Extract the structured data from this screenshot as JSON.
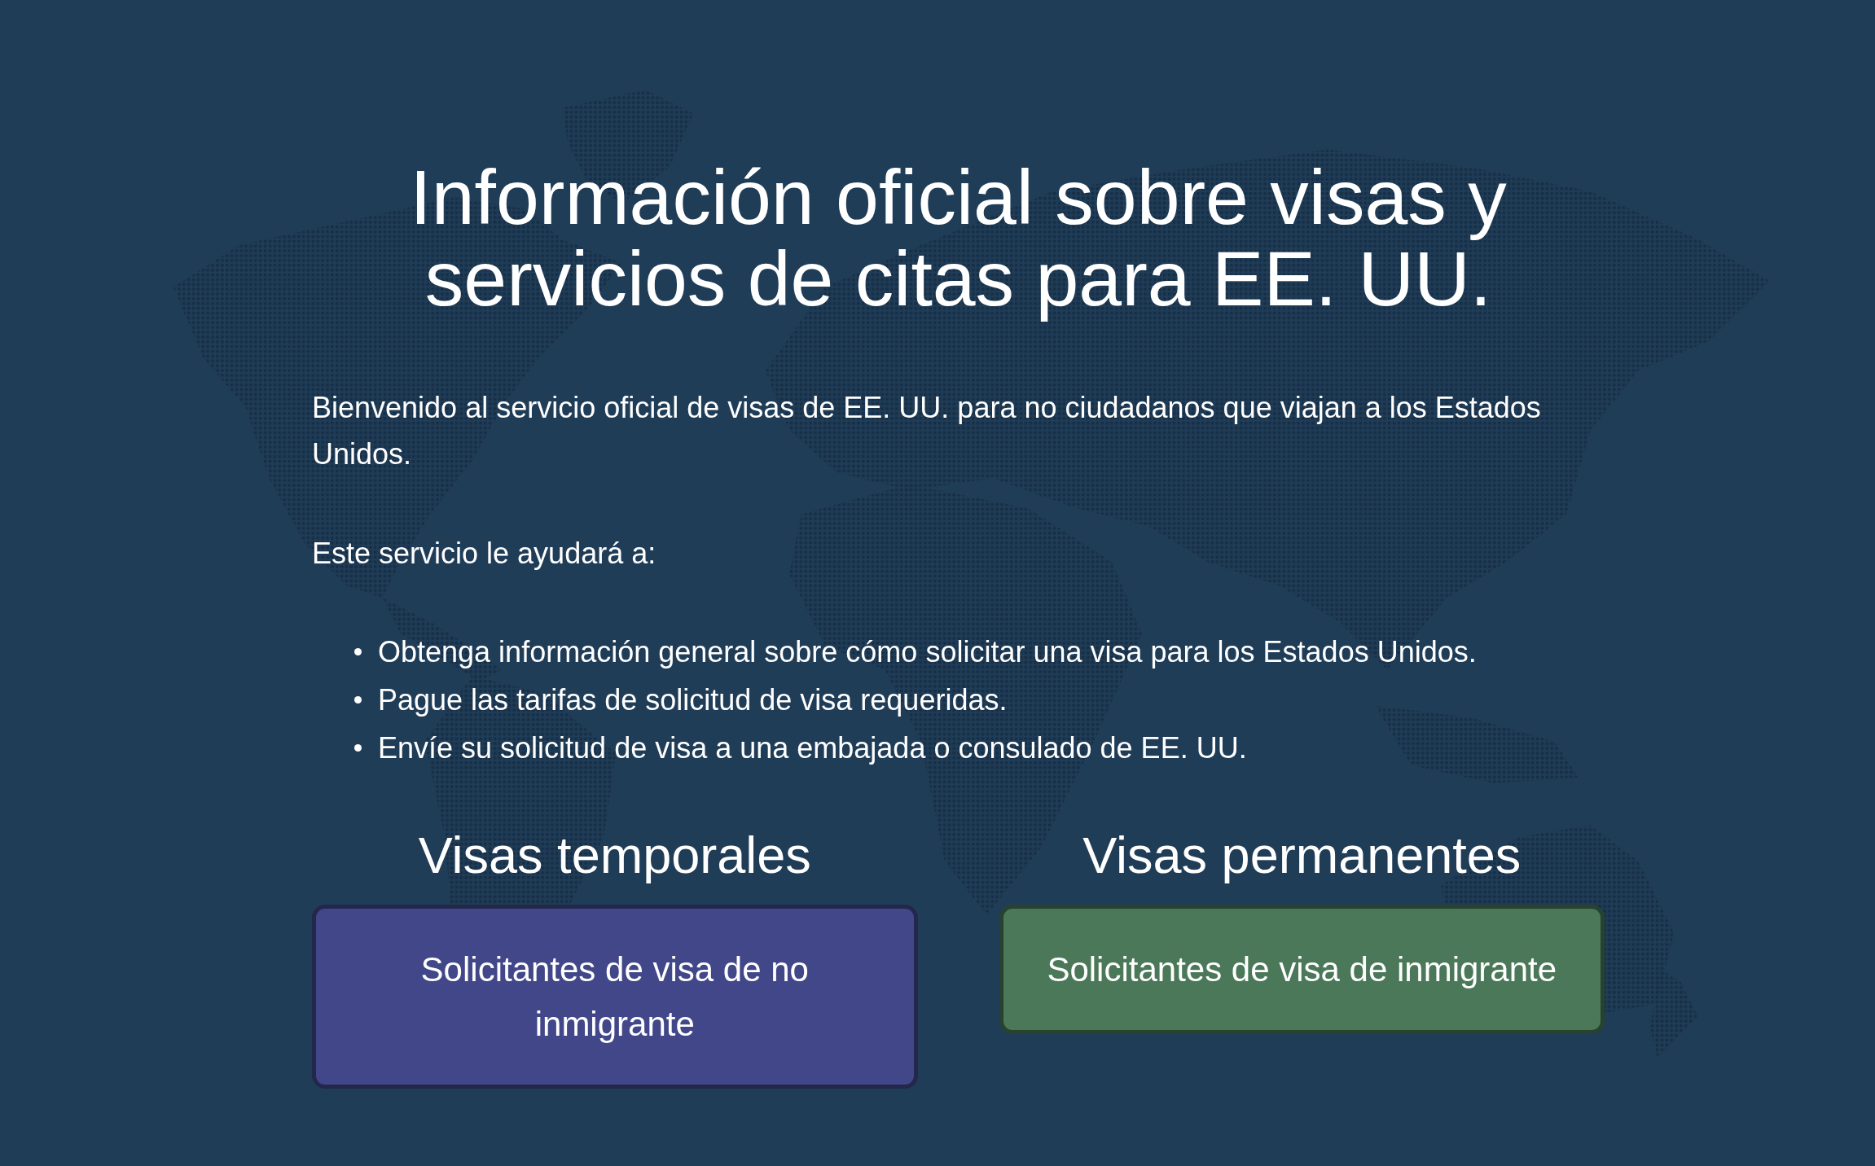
{
  "title": "Información oficial sobre visas y servicios de citas para EE. UU.",
  "intro": [
    "Bienvenido al servicio oficial de visas de EE. UU. para no ciudadanos que viajan a los Estados Unidos.",
    "Este servicio le ayudará a:"
  ],
  "services": [
    "Obtenga información general sobre cómo solicitar una visa para los Estados Unidos.",
    "Pague las tarifas de solicitud de visa requeridas.",
    "Envíe su solicitud de visa a una embajada o consulado de EE. UU."
  ],
  "categories": [
    {
      "heading": "Visas temporales",
      "button": "Solicitantes de visa de no inmigrante",
      "color": "#414789"
    },
    {
      "heading": "Visas permanentes",
      "button": "Solicitantes de visa de inmigrante",
      "color": "#4a7858"
    }
  ]
}
